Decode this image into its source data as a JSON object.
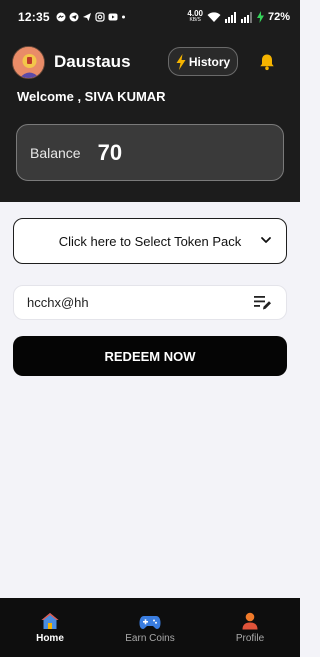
{
  "status_bar": {
    "time": "12:35",
    "net_speed_value": "4.00",
    "net_speed_unit": "KB/S",
    "battery": "72%"
  },
  "header": {
    "app_title": "Daustaus",
    "history_label": "History",
    "history_icon": "lightning-icon",
    "bell_icon": "bell-icon",
    "accent_color": "#f5b400"
  },
  "welcome_text": "Welcome , SIVA KUMAR",
  "balance": {
    "label": "Balance",
    "value": "70"
  },
  "token_pack": {
    "label": "Click here to Select Token Pack"
  },
  "email_field": {
    "value": "hcchx@hh"
  },
  "redeem_button": {
    "label": "REDEEM NOW"
  },
  "bottom_nav": {
    "items": [
      {
        "label": "Home",
        "icon": "home-icon",
        "active": true
      },
      {
        "label": "Earn Coins",
        "icon": "gamepad-icon",
        "active": false
      },
      {
        "label": "Profile",
        "icon": "user-icon",
        "active": false
      }
    ]
  }
}
